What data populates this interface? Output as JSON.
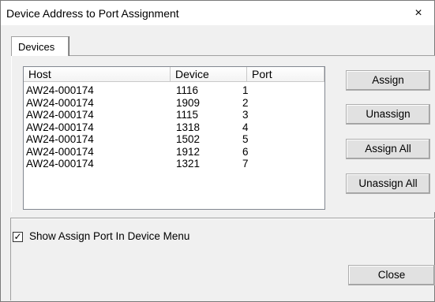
{
  "window": {
    "title": "Device Address to Port Assignment",
    "close_glyph": "×"
  },
  "tabs": [
    {
      "label": "Devices"
    }
  ],
  "table": {
    "columns": [
      "Host",
      "Device",
      "Port"
    ],
    "rows": [
      [
        "AW24-000174",
        "1116",
        "1"
      ],
      [
        "AW24-000174",
        "1909",
        "2"
      ],
      [
        "AW24-000174",
        "1115",
        "3"
      ],
      [
        "AW24-000174",
        "1318",
        "4"
      ],
      [
        "AW24-000174",
        "1502",
        "5"
      ],
      [
        "AW24-000174",
        "1912",
        "6"
      ],
      [
        "AW24-000174",
        "1321",
        "7"
      ]
    ]
  },
  "buttons": {
    "assign": "Assign",
    "unassign": "Unassign",
    "assign_all": "Assign All",
    "unassign_all": "Unassign All",
    "close": "Close"
  },
  "options": {
    "show_assign_port_label": "Show Assign Port In Device Menu",
    "show_assign_port_checked": true,
    "check_glyph": "✓"
  }
}
